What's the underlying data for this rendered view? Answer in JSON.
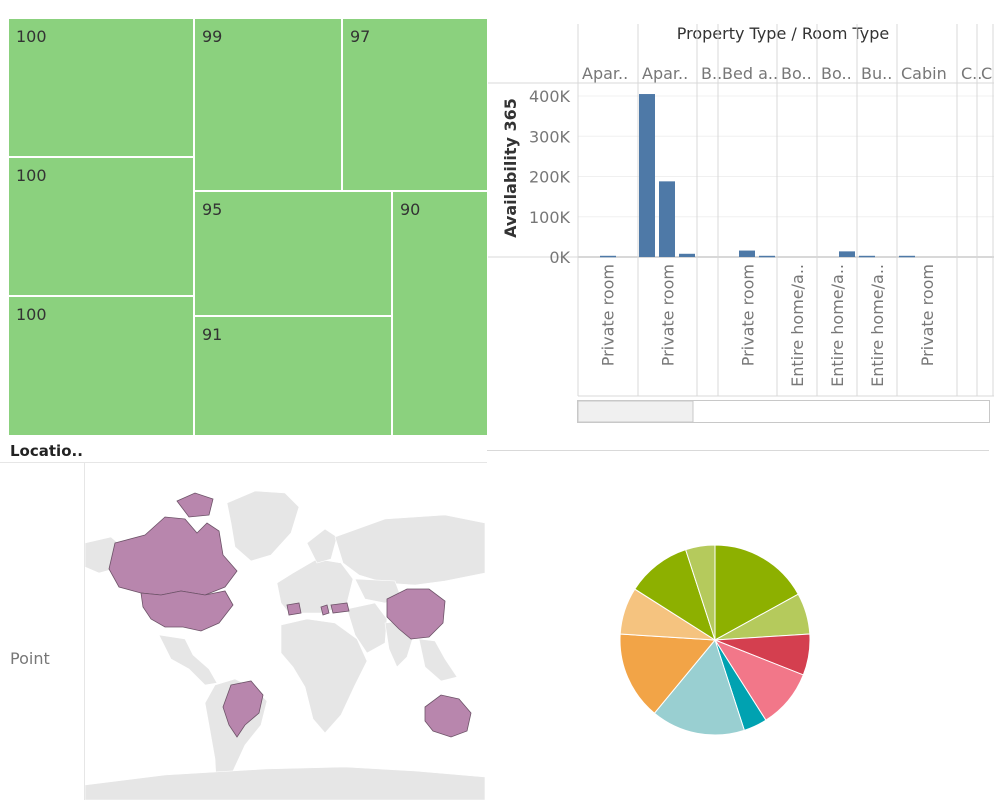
{
  "chart_data": [
    {
      "type": "treemap",
      "values": [
        100,
        100,
        100,
        99,
        97,
        95,
        91,
        90
      ]
    },
    {
      "type": "bar",
      "title": "Property Type  /  Room Type",
      "ylabel": "Availability 365",
      "ylim": [
        0,
        420000
      ],
      "y_ticks": [
        "0K",
        "100K",
        "200K",
        "300K",
        "400K"
      ],
      "y_tick_values": [
        0,
        100000,
        200000,
        300000,
        400000
      ],
      "property_types": [
        "Apar..",
        "Apar..",
        "B..",
        "Bed a..",
        "Bo..",
        "Bo..",
        "Bu..",
        "Cabin",
        "C..",
        "C"
      ],
      "room_type_labels": [
        "Private room",
        "Private room",
        "",
        "Private room",
        "Entire home/a..",
        "Entire home/a..",
        "Entire home/a..",
        "Private room",
        "",
        ""
      ],
      "bars": [
        {
          "group": 0,
          "value": 3000
        },
        {
          "group": 1,
          "value": 405000
        },
        {
          "group": 1,
          "value": 188000
        },
        {
          "group": 1,
          "value": 8000
        },
        {
          "group": 3,
          "value": 16000
        },
        {
          "group": 3,
          "value": 3000
        },
        {
          "group": 5,
          "value": 14000
        },
        {
          "group": 6,
          "value": 3000
        },
        {
          "group": 7,
          "value": 3000
        }
      ],
      "bar_color": "#4e79a7"
    },
    {
      "type": "map",
      "column_header": "Locatio..",
      "row_label": "Point",
      "highlighted_regions": [
        "Canada",
        "United States",
        "Brazil",
        "Spain",
        "Greece",
        "Turkey",
        "China",
        "Australia"
      ],
      "highlight_color": "#b886ad",
      "base_color": "#e6e6e6"
    },
    {
      "type": "pie",
      "slices": [
        {
          "value": 17,
          "color": "#8db000"
        },
        {
          "value": 7,
          "color": "#b5ca5c"
        },
        {
          "value": 7,
          "color": "#d43f4f"
        },
        {
          "value": 10,
          "color": "#f27789"
        },
        {
          "value": 4,
          "color": "#00a2b1"
        },
        {
          "value": 16,
          "color": "#99cfd1"
        },
        {
          "value": 15,
          "color": "#f2a447"
        },
        {
          "value": 8,
          "color": "#f5c37f"
        },
        {
          "value": 11,
          "color": "#8db000"
        },
        {
          "value": 5,
          "color": "#b5ca5c"
        }
      ]
    }
  ]
}
